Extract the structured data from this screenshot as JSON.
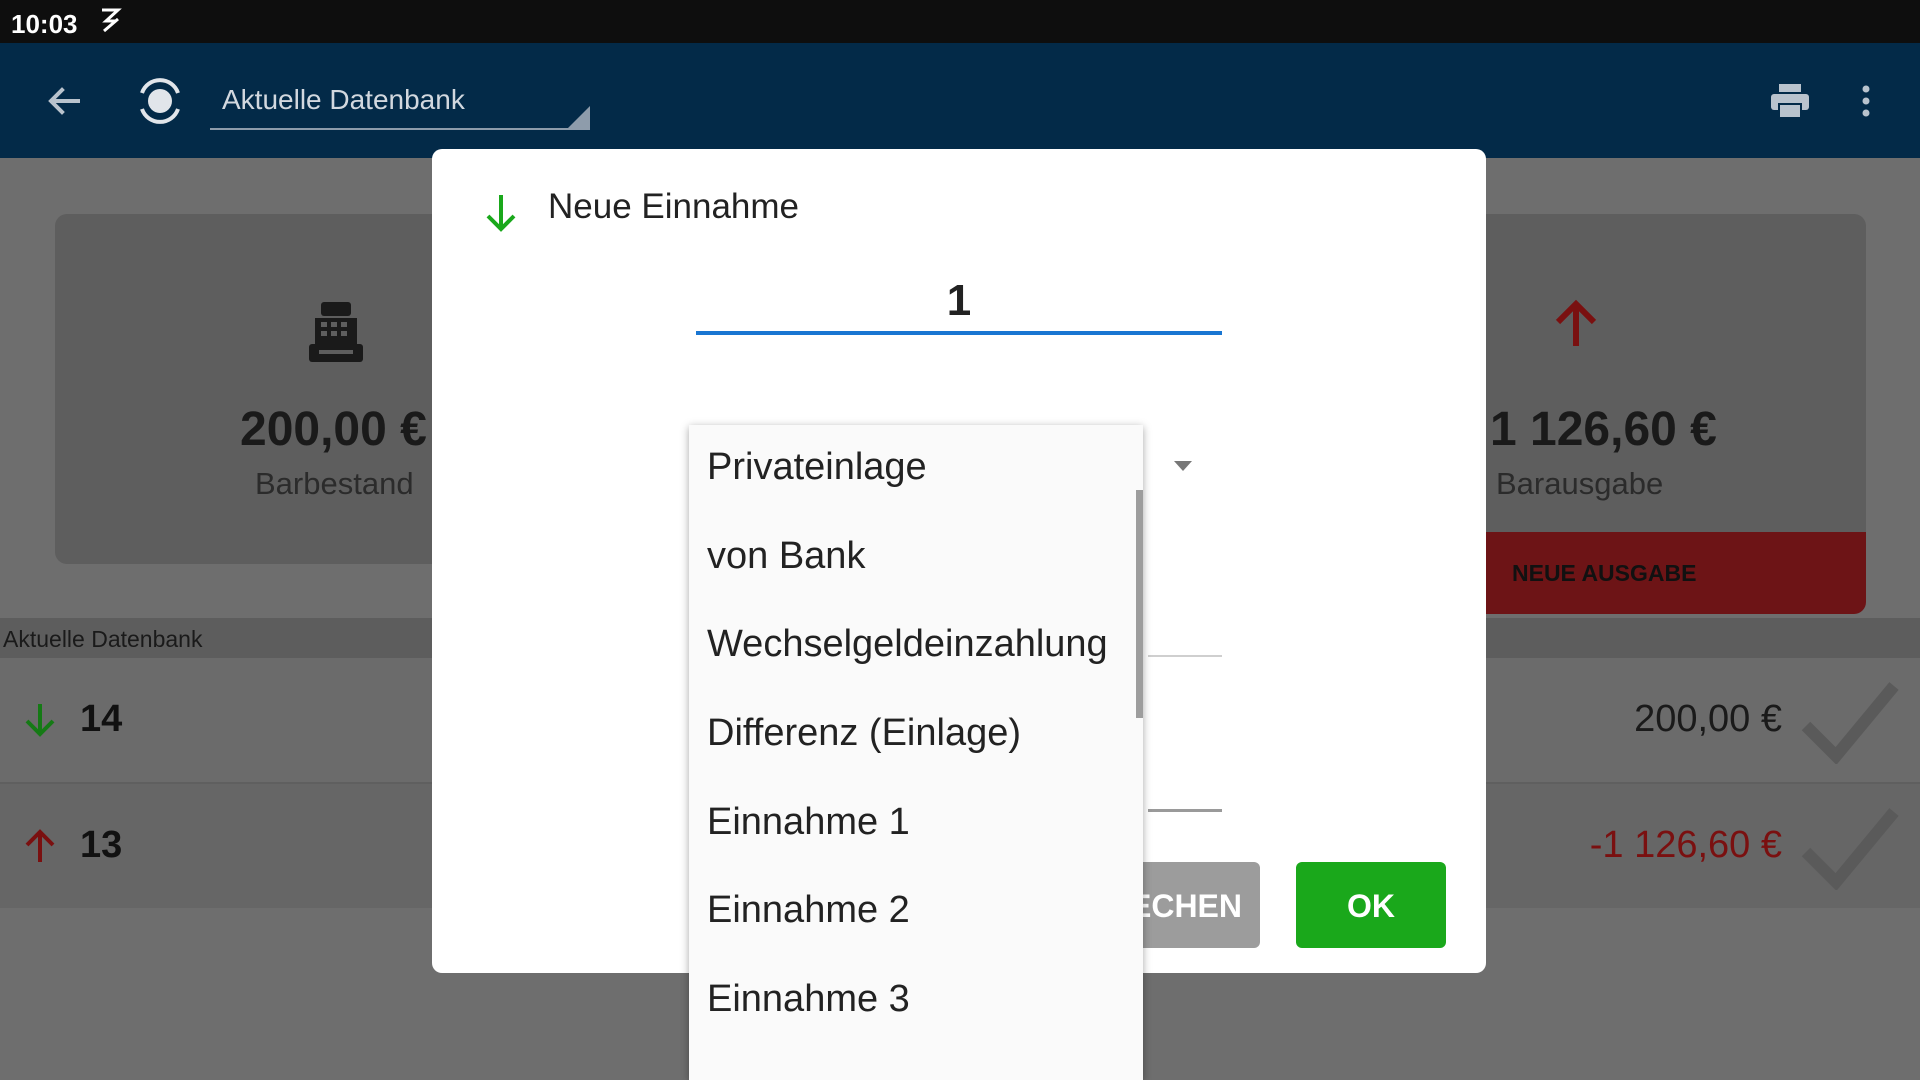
{
  "status_bar": {
    "time": "10:03"
  },
  "app_bar": {
    "spinner_value": "Aktuelle Datenbank"
  },
  "summary": {
    "left_card": {
      "amount": "200,00 €",
      "caption": "Barbestand"
    },
    "right_card": {
      "amount": "1 126,60 €",
      "caption": "Barausgabe",
      "button_label": "NEUE AUSGABE"
    }
  },
  "list": {
    "header": "Aktuelle Datenbank",
    "rows": [
      {
        "number": "14",
        "direction": "in",
        "amount": "200,00 €",
        "amount_color": "#1a1a1a"
      },
      {
        "number": "13",
        "direction": "out",
        "amount": "-1 126,60 €",
        "amount_color": "#8b1a1a"
      }
    ]
  },
  "dialog": {
    "title": "Neue Einnahme",
    "amount_value": "1",
    "cancel_label": "ECHEN",
    "ok_label": "OK"
  },
  "dropdown": {
    "items": [
      "Privateinlage",
      "von Bank",
      "Wechselgeldeinzahlung",
      "Differenz (Einlage)",
      "Einnahme 1",
      "Einnahme 2",
      "Einnahme 3"
    ]
  },
  "colors": {
    "app_bar": "#032a48",
    "ok_green": "#1aa81b",
    "income_green": "#1aa81b",
    "expense_red": "#d01a1a",
    "input_underline": "#1976d2"
  }
}
